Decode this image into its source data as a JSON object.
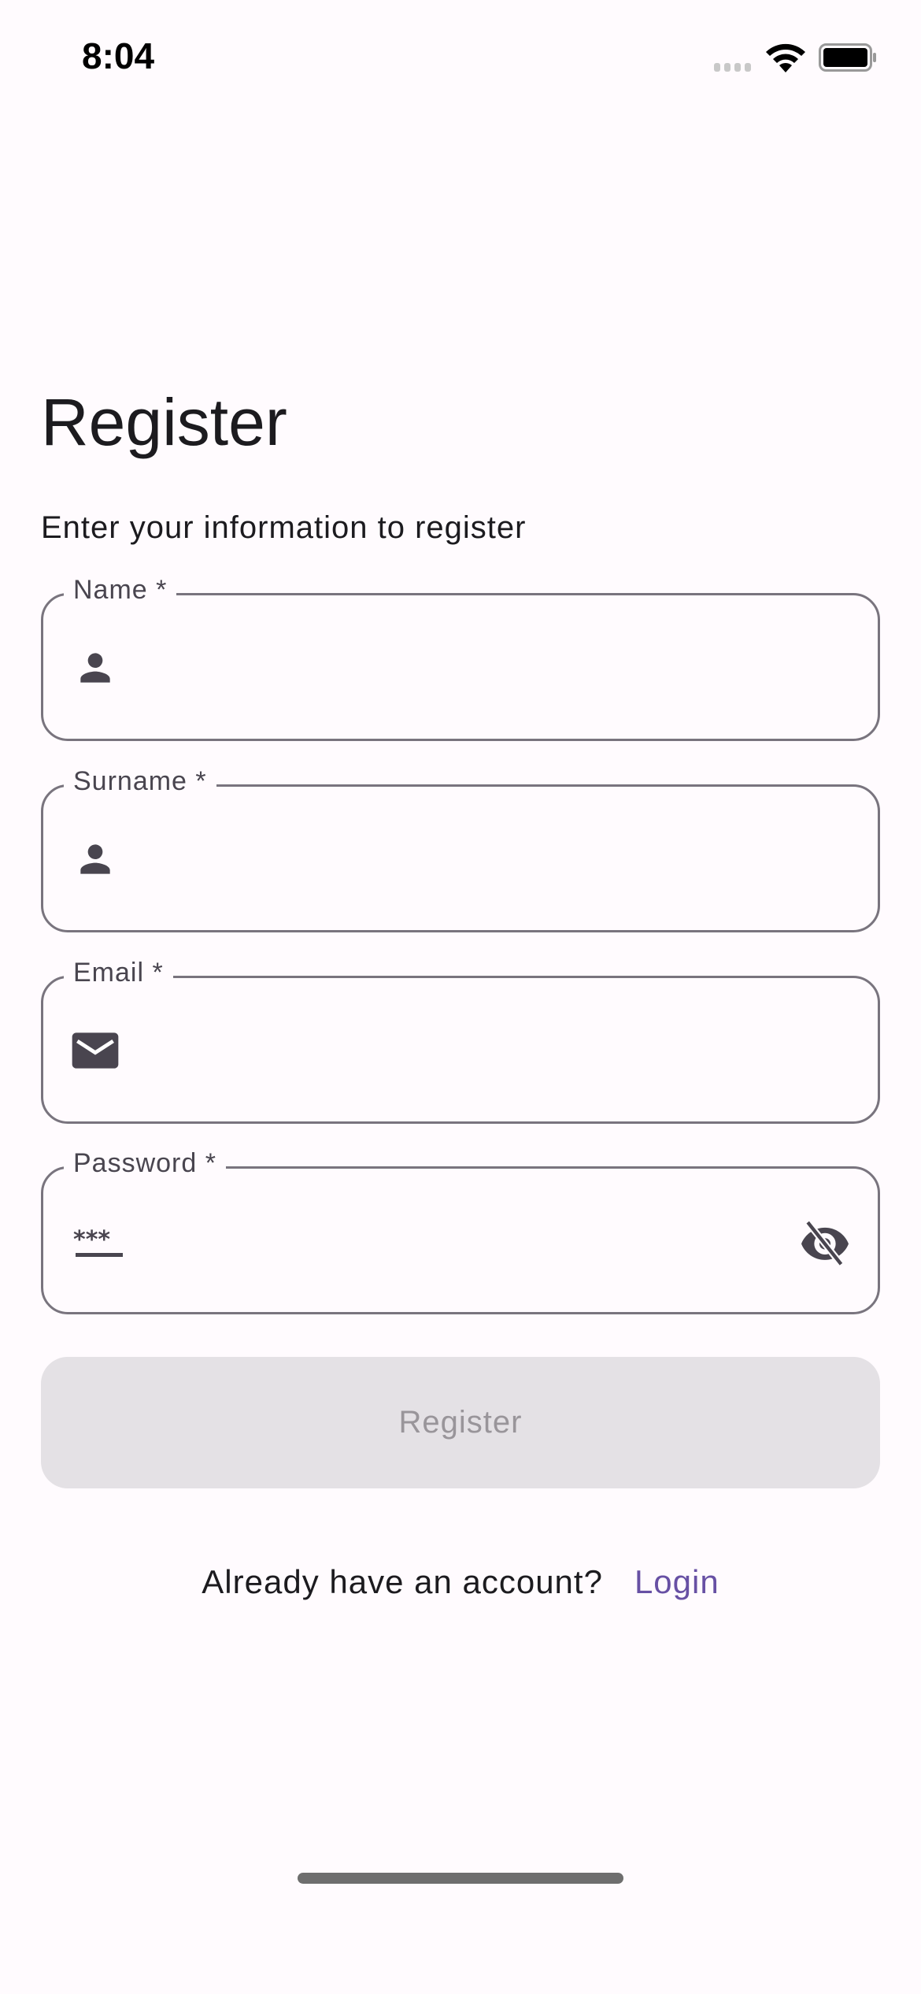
{
  "status_bar": {
    "time": "8:04"
  },
  "title": "Register",
  "subtitle": "Enter your information to register",
  "fields": [
    {
      "label": "Name *",
      "icon": "person-icon",
      "value": ""
    },
    {
      "label": "Surname *",
      "icon": "person-icon",
      "value": ""
    },
    {
      "label": "Email *",
      "icon": "mail-icon",
      "value": ""
    },
    {
      "label": "Password *",
      "icon": "password-icon",
      "value": "",
      "trailing_icon": "visibility-off-icon"
    }
  ],
  "register_button": "Register",
  "footer": {
    "prompt": "Already have an account?",
    "login_link": "Login"
  },
  "colors": {
    "accent": "#6750a4",
    "border": "#79747e",
    "icon": "#49454f",
    "button_bg": "#e4e1e5"
  }
}
